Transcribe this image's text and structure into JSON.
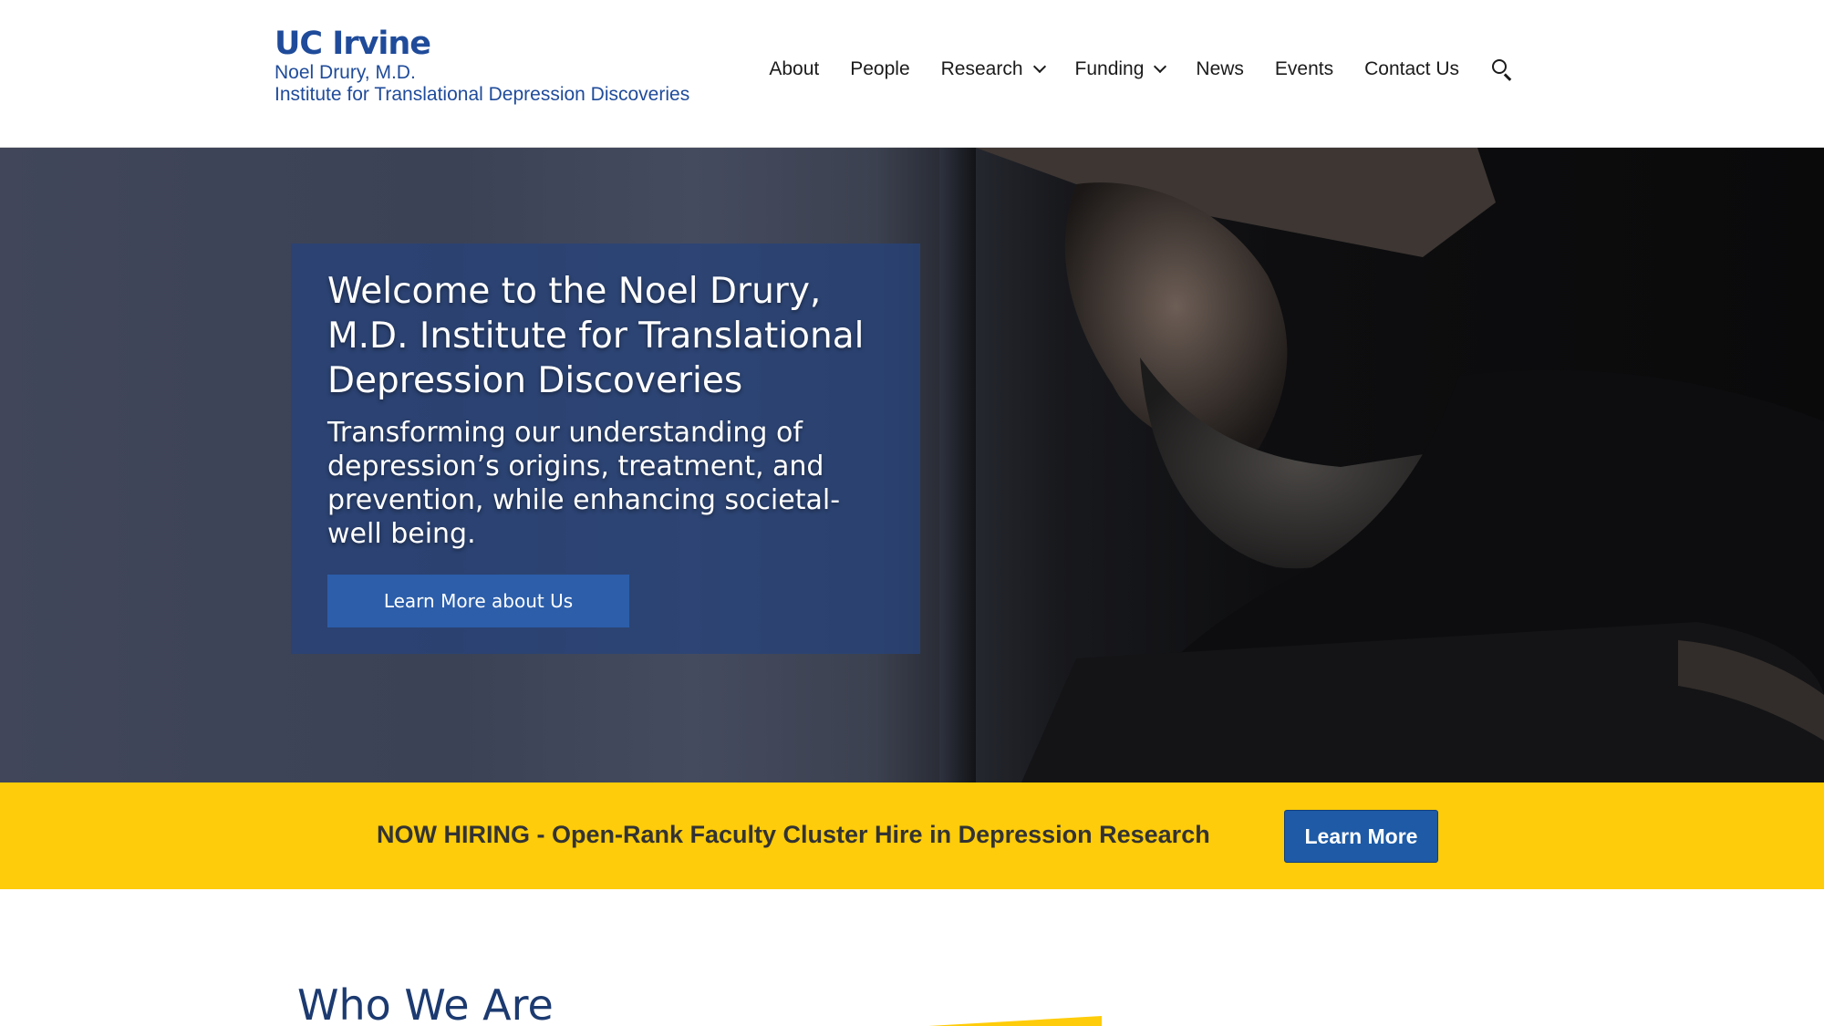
{
  "header": {
    "logo": {
      "university": "UC Irvine",
      "name": "Noel Drury, M.D.",
      "institute": "Institute for Translational Depression Discoveries"
    },
    "nav": [
      {
        "label": "About",
        "has_dropdown": false
      },
      {
        "label": "People",
        "has_dropdown": false
      },
      {
        "label": "Research",
        "has_dropdown": true
      },
      {
        "label": "Funding",
        "has_dropdown": true
      },
      {
        "label": "News",
        "has_dropdown": false
      },
      {
        "label": "Events",
        "has_dropdown": false
      },
      {
        "label": "Contact Us",
        "has_dropdown": false
      }
    ],
    "search_icon": "search-icon"
  },
  "hero": {
    "title": "Welcome to the Noel Drury, M.D. Institute for Translational Depression Discoveries",
    "subtitle": "Transforming our understanding of depression’s origins, treatment, and prevention, while enhancing societal-well being.",
    "button_label": "Learn More about Us"
  },
  "banner": {
    "text": "NOW HIRING - Open-Rank Faculty Cluster Hire in Depression Research",
    "button_label": "Learn More"
  },
  "who_we_are": {
    "title": "Who We Are"
  },
  "colors": {
    "brand_blue": "#1f4b9a",
    "hero_card": "#26437a",
    "hero_button": "#2c5eaa",
    "banner_yellow": "#fecc0a",
    "banner_button": "#1e5aa5",
    "heading_navy": "#1c3a70"
  }
}
